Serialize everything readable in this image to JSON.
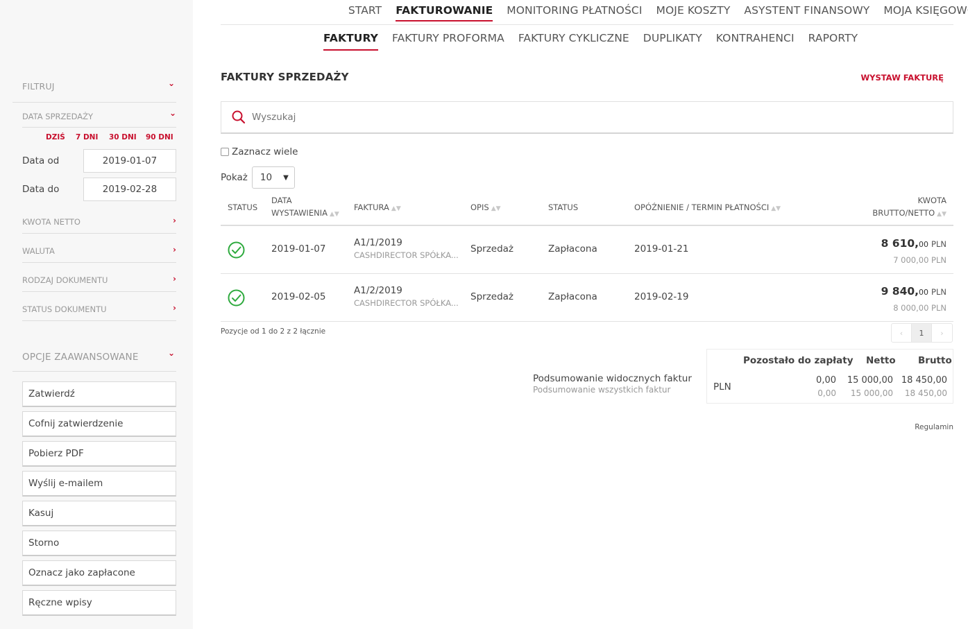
{
  "nav": {
    "main": [
      "START",
      "FAKTUROWANIE",
      "MONITORING PŁATNOŚCI",
      "MOJE KOSZTY",
      "ASYSTENT FINANSOWY",
      "MOJA KSIĘGOWOŚĆ"
    ],
    "main_active": "FAKTUROWANIE",
    "sub": [
      "FAKTURY",
      "FAKTURY PROFORMA",
      "FAKTURY CYKLICZNE",
      "DUPLIKATY",
      "KONTRAHENCI",
      "RAPORTY"
    ],
    "sub_active": "FAKTURY"
  },
  "page": {
    "title": "FAKTURY SPRZEDAŻY",
    "issue_button": "WYSTAW FAKTURĘ",
    "search_placeholder": "Wyszukaj",
    "select_many": "Zaznacz wiele",
    "show_label": "Pokaż",
    "show_value": "10",
    "info": "Pozycje od 1 do 2 z 2 łącznie",
    "current_page": "1",
    "terms_link": "Regulamin"
  },
  "table": {
    "headers": {
      "status_icon": "STATUS",
      "date_line1": "DATA",
      "date_line2": "WYSTAWIENIA",
      "invoice": "FAKTURA",
      "desc": "OPIS",
      "status": "STATUS",
      "delay": "OPÓŹNIENIE / TERMIN PŁATNOŚCI",
      "amount_line1": "KWOTA",
      "amount_line2": "BRUTTO/NETTO"
    },
    "rows": [
      {
        "date": "2019-01-07",
        "invoice": "A1/1/2019",
        "client": "CASHDIRECTOR SPÓŁKA...",
        "desc": "Sprzedaż",
        "status": "Zapłacona",
        "due": "2019-01-21",
        "gross_int": "8 610,",
        "gross_dec": "00",
        "currency": "PLN",
        "net": "7 000,00 PLN"
      },
      {
        "date": "2019-02-05",
        "invoice": "A1/2/2019",
        "client": "CASHDIRECTOR SPÓŁKA...",
        "desc": "Sprzedaż",
        "status": "Zapłacona",
        "due": "2019-02-19",
        "gross_int": "9 840,",
        "gross_dec": "00",
        "currency": "PLN",
        "net": "8 000,00 PLN"
      }
    ]
  },
  "summary": {
    "label_visible": "Podsumowanie widocznych faktur",
    "label_all": "Podsumowanie wszystkich faktur",
    "head_remaining": "Pozostało do zapłaty",
    "head_net": "Netto",
    "head_gross": "Brutto",
    "currency": "PLN",
    "visible": {
      "remaining": "0,00",
      "net": "15 000,00",
      "gross": "18 450,00"
    },
    "all": {
      "remaining": "0,00",
      "net": "15 000,00",
      "gross": "18 450,00"
    }
  },
  "sidebar": {
    "filter_title": "FILTRUJ",
    "sale_date": "DATA SPRZEDAŻY",
    "quick": [
      "DZIŚ",
      "7 DNI",
      "30 DNI",
      "90 DNI"
    ],
    "date_from_label": "Data od",
    "date_from": "2019-01-07",
    "date_to_label": "Data do",
    "date_to": "2019-02-28",
    "filters": [
      "KWOTA NETTO",
      "WALUTA",
      "RODZAJ DOKUMENTU",
      "STATUS DOKUMENTU"
    ],
    "advanced_title": "OPCJE ZAAWANSOWANE",
    "actions": [
      "Zatwierdź",
      "Cofnij zatwierdzenie",
      "Pobierz PDF",
      "Wyślij e-mailem",
      "Kasuj",
      "Storno",
      "Oznacz jako zapłacone",
      "Ręczne wpisy"
    ]
  },
  "colors": {
    "accent": "#c8102e",
    "ok": "#2eaa3e"
  }
}
